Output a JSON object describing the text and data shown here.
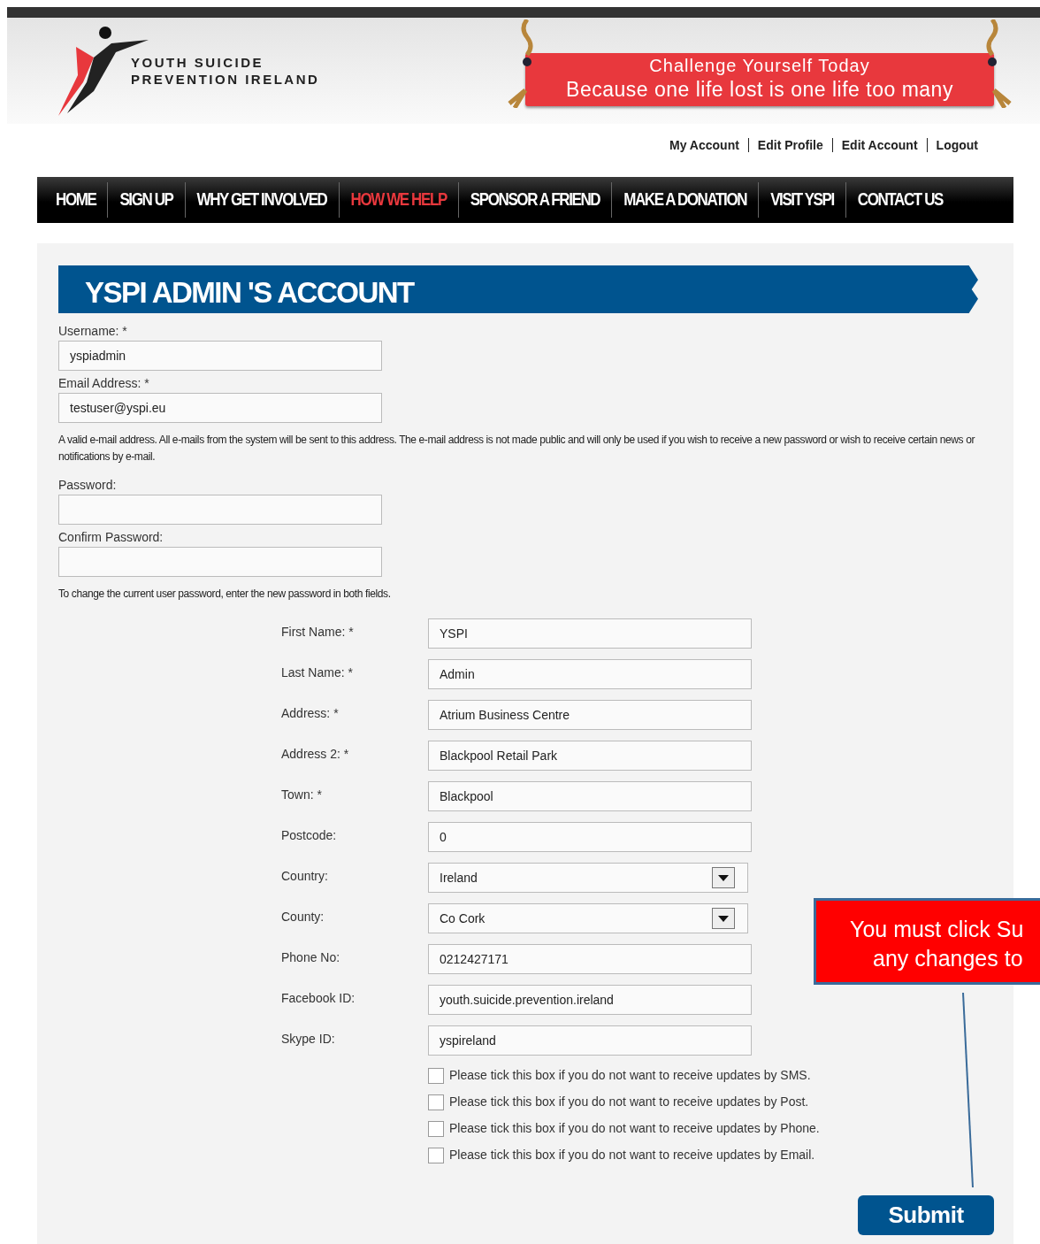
{
  "header": {
    "logo_lines": [
      "YOUTH SUICIDE",
      "PREVENTION IRELAND"
    ],
    "banner": {
      "line_1": "Challenge Yourself Today",
      "line_2": "Because one life lost is one life too many"
    }
  },
  "user_links": [
    "My Account",
    "Edit Profile",
    "Edit Account",
    "Logout"
  ],
  "nav": [
    {
      "label": "HOME",
      "selected": false
    },
    {
      "label": "SIGN UP",
      "selected": false
    },
    {
      "label": "WHY GET INVOLVED",
      "selected": false
    },
    {
      "label": "HOW WE HELP",
      "selected": true
    },
    {
      "label": "SPONSOR A FRIEND",
      "selected": false
    },
    {
      "label": "MAKE A DONATION",
      "selected": false
    },
    {
      "label": "VISIT YSPI",
      "selected": false
    },
    {
      "label": "CONTACT US",
      "selected": false
    }
  ],
  "page_title": "YSPI ADMIN 'S ACCOUNT",
  "account_items": [
    {
      "kind": "field",
      "label": "Username: *",
      "value": "yspiadmin"
    },
    {
      "kind": "field",
      "label": "Email Address: *",
      "value": "testuser@yspi.eu"
    },
    {
      "kind": "help",
      "text": "A valid e-mail address. All e-mails from the system will be sent to this address. The e-mail address is not made public and will only be used if you wish to receive a new password or wish to receive certain news or notifications by e-mail."
    },
    {
      "kind": "field",
      "label": "Password:"
    },
    {
      "kind": "field",
      "label": "Confirm Password:"
    },
    {
      "kind": "help",
      "text": "To change the current user password, enter the new password in both fields."
    }
  ],
  "profile_fields": [
    {
      "kind": "text",
      "label": "First Name: *",
      "value": "YSPI"
    },
    {
      "kind": "text",
      "label": "Last Name: *",
      "value": "Admin"
    },
    {
      "kind": "text",
      "label": "Address: *",
      "value": "Atrium Business Centre"
    },
    {
      "kind": "text",
      "label": "Address 2: *",
      "value": "Blackpool Retail Park"
    },
    {
      "kind": "text",
      "label": "Town: *",
      "value": "Blackpool"
    },
    {
      "kind": "text",
      "label": "Postcode:",
      "value": "0"
    },
    {
      "kind": "select",
      "label": "Country:",
      "value": "Ireland"
    },
    {
      "kind": "select",
      "label": "County:",
      "value": "Co Cork"
    },
    {
      "kind": "text",
      "label": "Phone No:",
      "value": "0212427171"
    },
    {
      "kind": "text",
      "label": "Facebook ID:",
      "value": "youth.suicide.prevention.ireland"
    },
    {
      "kind": "text",
      "label": "Skype ID:",
      "value": "yspireland"
    }
  ],
  "opt_outs": [
    {
      "label": "Please tick this box if you do not want to receive updates by SMS.",
      "checked": false
    },
    {
      "label": "Please tick this box if you do not want to receive updates by Post.",
      "checked": false
    },
    {
      "label": "Please tick this box if you do not want to receive updates by Phone.",
      "checked": false
    },
    {
      "label": "Please tick this box if you do not want to receive updates by Email.",
      "checked": false
    }
  ],
  "callout": {
    "lines": [
      "You must click Su",
      "any changes to"
    ]
  },
  "submit": "Submit"
}
